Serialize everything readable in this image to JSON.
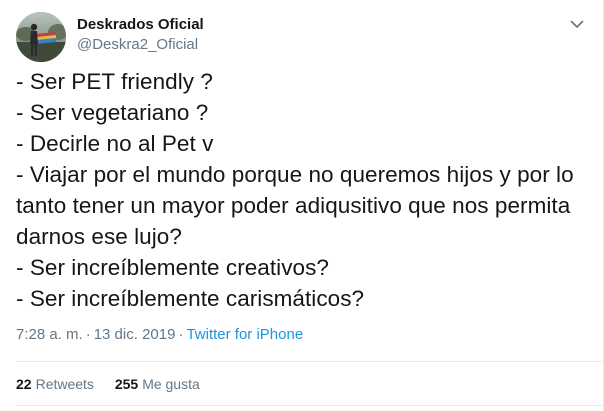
{
  "author": {
    "display_name": "Deskrados Oficial",
    "handle": "@Deskra2_Oficial"
  },
  "icons": {
    "menu": "chevron-down-icon",
    "avatar": "profile-photo"
  },
  "tweet": {
    "lines": [
      "- Ser PET friendly ?",
      "- Ser vegetariano ?",
      "- Decirle no al Pet v",
      "- Viajar por el mundo porque no queremos hijos y por lo",
      "tanto tener un mayor poder adiqusitivo que nos permita",
      "darnos ese lujo?",
      "- Ser increíblemente creativos?",
      "- Ser increíblemente carismáticos?"
    ]
  },
  "meta": {
    "time": "7:28 a. m.",
    "separator": "·",
    "date": "13 dic. 2019",
    "source": "Twitter for iPhone"
  },
  "stats": {
    "retweets_count": "22",
    "retweets_label": "Retweets",
    "likes_count": "255",
    "likes_label": "Me gusta"
  },
  "colors": {
    "text": "#14171a",
    "secondary": "#657786",
    "link": "#1b95e0",
    "border": "#e6ecf0"
  }
}
